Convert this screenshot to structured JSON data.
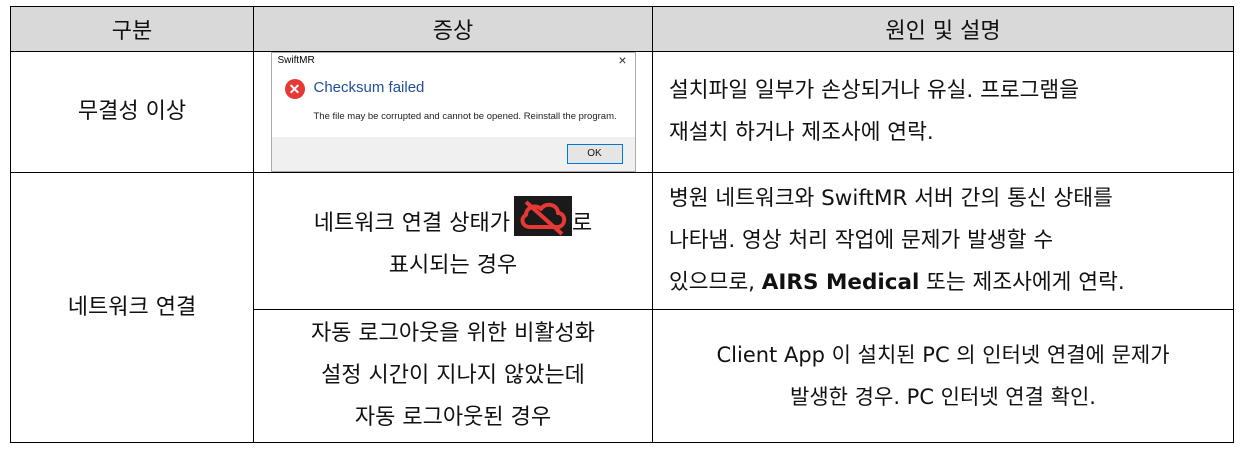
{
  "header": {
    "col1": "구분",
    "col2": "증상",
    "col3": "원인 및 설명"
  },
  "rows": [
    {
      "category": "무결성 이상",
      "dialog": {
        "title": "SwiftMR",
        "close": "×",
        "heading": "Checksum failed",
        "message": "The file may be corrupted and cannot be opened. Reinstall the program.",
        "ok": "OK",
        "icon": "error-x-icon"
      },
      "cause_line1": "설치파일 일부가 손상되거나 유실. 프로그램을",
      "cause_line2": "재설치 하거나 제조사에 연락."
    },
    {
      "category": "네트워크 연결",
      "symptom_a_pre": "네트워크 연결 상태가",
      "symptom_a_post": "로",
      "symptom_a_line2": "표시되는 경우",
      "icon": "cloud-offline-icon",
      "cause_line1": "병원 네트워크와 SwiftMR 서버 간의 통신 상태를",
      "cause_line2": "나타냄. 영상 처리 작업에 문제가 발생할 수",
      "cause_line3_pre": "있으므로, ",
      "cause_line3_bold": "AIRS Medical",
      "cause_line3_post": " 또는 제조사에게 연락.",
      "symptom_b_line1": "자동 로그아웃을 위한 비활성화",
      "symptom_b_line2": "설정 시간이 지나지 않았는데",
      "symptom_b_line3": "자동 로그아웃된 경우",
      "cause_b_line1": "Client App 이 설치된 PC 의 인터넷 연결에 문제가",
      "cause_b_line2": "발생한 경우. PC 인터넷 연결 확인."
    }
  ]
}
